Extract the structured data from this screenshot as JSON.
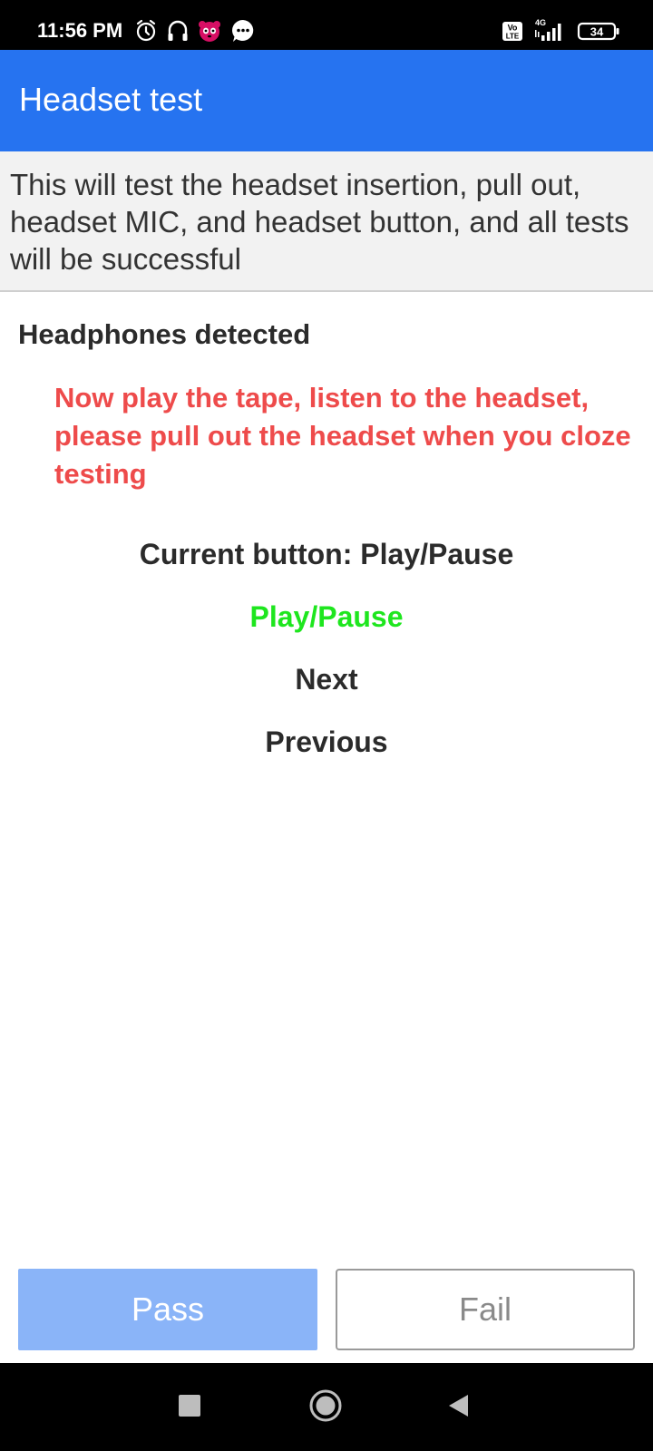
{
  "status_bar": {
    "time": "11:56 PM",
    "battery_level": "34",
    "network_type": "4G",
    "volte_badge_line1": "Vo",
    "volte_badge_line2": "LTE",
    "icons": [
      "alarm-icon",
      "headset-icon",
      "foodpanda-icon",
      "chat-icon",
      "volte-icon",
      "signal-icon",
      "battery-icon"
    ]
  },
  "app_bar": {
    "title": "Headset test",
    "background_color": "#2673f0"
  },
  "description": {
    "text": "This will test the headset insertion, pull out, headset MIC, and headset button, and all tests will be successful"
  },
  "status": {
    "detected": "Headphones detected",
    "instruction": "Now play the tape, listen to the headset, please pull out the headset when you cloze testing",
    "instruction_color": "#ee4b4b"
  },
  "buttons_panel": {
    "current_button": "Current button: Play/Pause",
    "items": [
      {
        "label": "Play/Pause",
        "color": "#1ee61e"
      },
      {
        "label": "Next",
        "color": "#2b2b2b"
      },
      {
        "label": "Previous",
        "color": "#2b2b2b"
      }
    ]
  },
  "actions": {
    "pass_label": "Pass",
    "fail_label": "Fail",
    "pass_color": "#8ab4f8"
  },
  "nav_bar": {
    "icons": [
      "recent-apps-icon",
      "home-icon",
      "back-icon"
    ]
  }
}
